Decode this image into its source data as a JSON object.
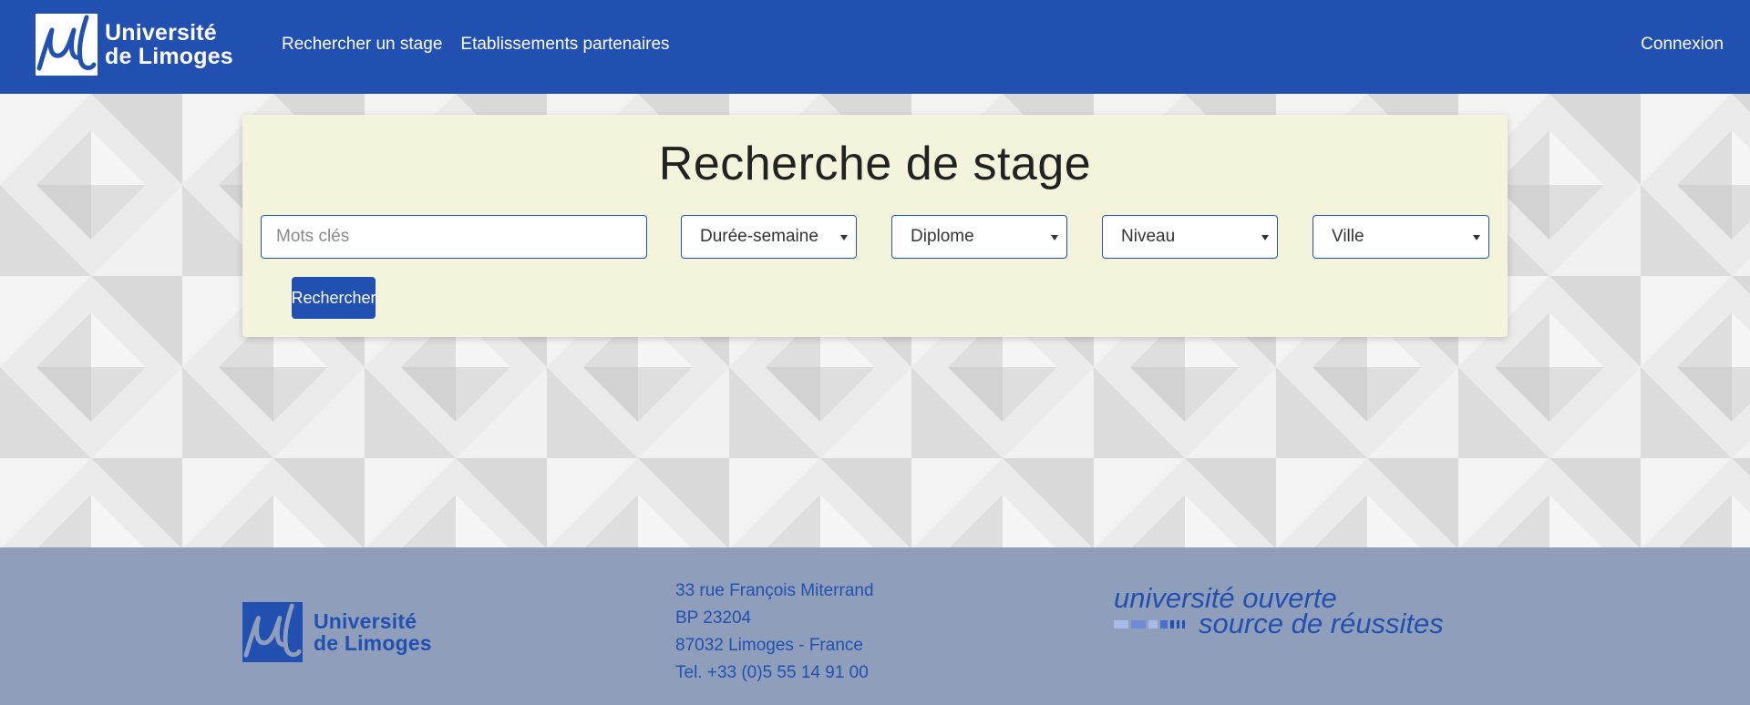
{
  "header": {
    "logo_line1": "Université",
    "logo_line2": "de Limoges",
    "nav": [
      "Rechercher un stage",
      "Etablissements partenaires"
    ],
    "login": "Connexion"
  },
  "search": {
    "title": "Recherche de stage",
    "keywords_placeholder": "Mots clés",
    "selects": [
      "Durée-semaine",
      "Diplome",
      "Niveau",
      "Ville"
    ],
    "button": "Rechercher"
  },
  "footer": {
    "logo_line1": "Université",
    "logo_line2": "de Limoges",
    "address": [
      "33 rue François Miterrand",
      "BP 23204",
      "87032 Limoges - France",
      "Tel. +33 (0)5 55 14 91 00"
    ],
    "slogan_line1": "université ouverte",
    "slogan_line2": "source de réussites"
  },
  "colors": {
    "brand_blue": "#2250b0",
    "panel_bg": "#f4f4dc",
    "footer_bg": "#8f9fbb"
  },
  "icons": [
    "ul-logo-icon",
    "chevron-down-icon"
  ]
}
